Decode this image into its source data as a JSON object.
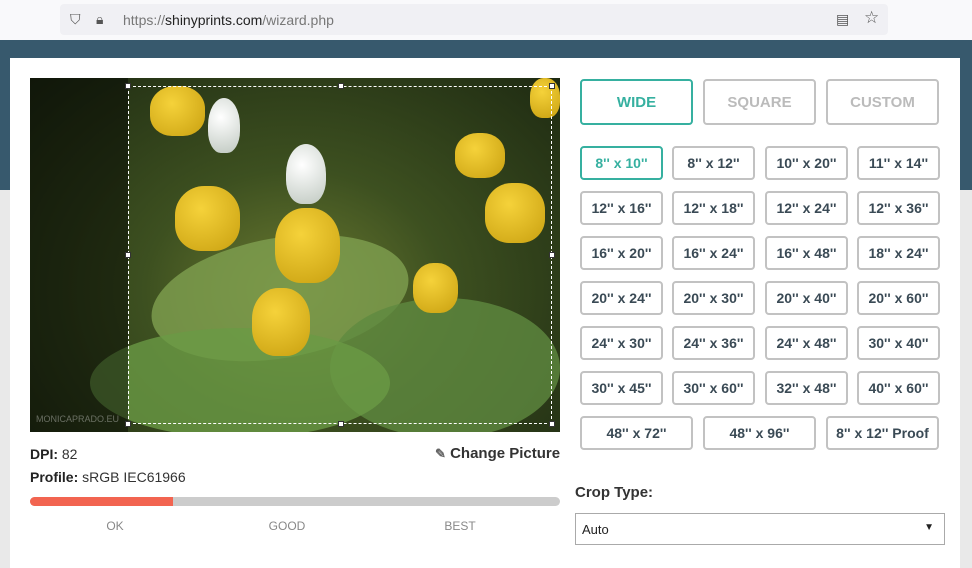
{
  "browser": {
    "url_prefix": "https://",
    "url_domain": "shinyprints.com",
    "url_path": "/wizard.php",
    "icons": [
      "shield-icon",
      "lock-icon",
      "reader-icon",
      "star-icon"
    ]
  },
  "photo": {
    "watermark": "MONICAPRADO.EU"
  },
  "info": {
    "dpi_label": "DPI:",
    "dpi_value": "82",
    "profile_label": "Profile:",
    "profile_value": "sRGB IEC61966",
    "change_picture": "Change Picture"
  },
  "quality": {
    "percent": 27,
    "labels": [
      "OK",
      "GOOD",
      "BEST"
    ],
    "fill_color": "#f26450"
  },
  "tabs": [
    {
      "label": "WIDE",
      "active": true
    },
    {
      "label": "SQUARE"
    },
    {
      "label": "CUSTOM"
    }
  ],
  "sizes": [
    "8'' x 10''",
    "8'' x 12''",
    "10'' x 20''",
    "11'' x 14''",
    "12'' x 16''",
    "12'' x 18''",
    "12'' x 24''",
    "12'' x 36''",
    "16'' x 20''",
    "16'' x 24''",
    "16'' x 48''",
    "18'' x 24''",
    "20'' x 24''",
    "20'' x 30''",
    "20'' x 40''",
    "20'' x 60''",
    "24'' x 30''",
    "24'' x 36''",
    "24'' x 48''",
    "30'' x 40''",
    "30'' x 45''",
    "30'' x 60''",
    "32'' x 48''",
    "40'' x 60''"
  ],
  "sizes_last": [
    "48'' x 72''",
    "48'' x 96''",
    "8'' x 12'' Proof"
  ],
  "selected_size": "8'' x 10''",
  "crop": {
    "label": "Crop Type:",
    "value": "Auto"
  },
  "accent": "#36b0a0"
}
